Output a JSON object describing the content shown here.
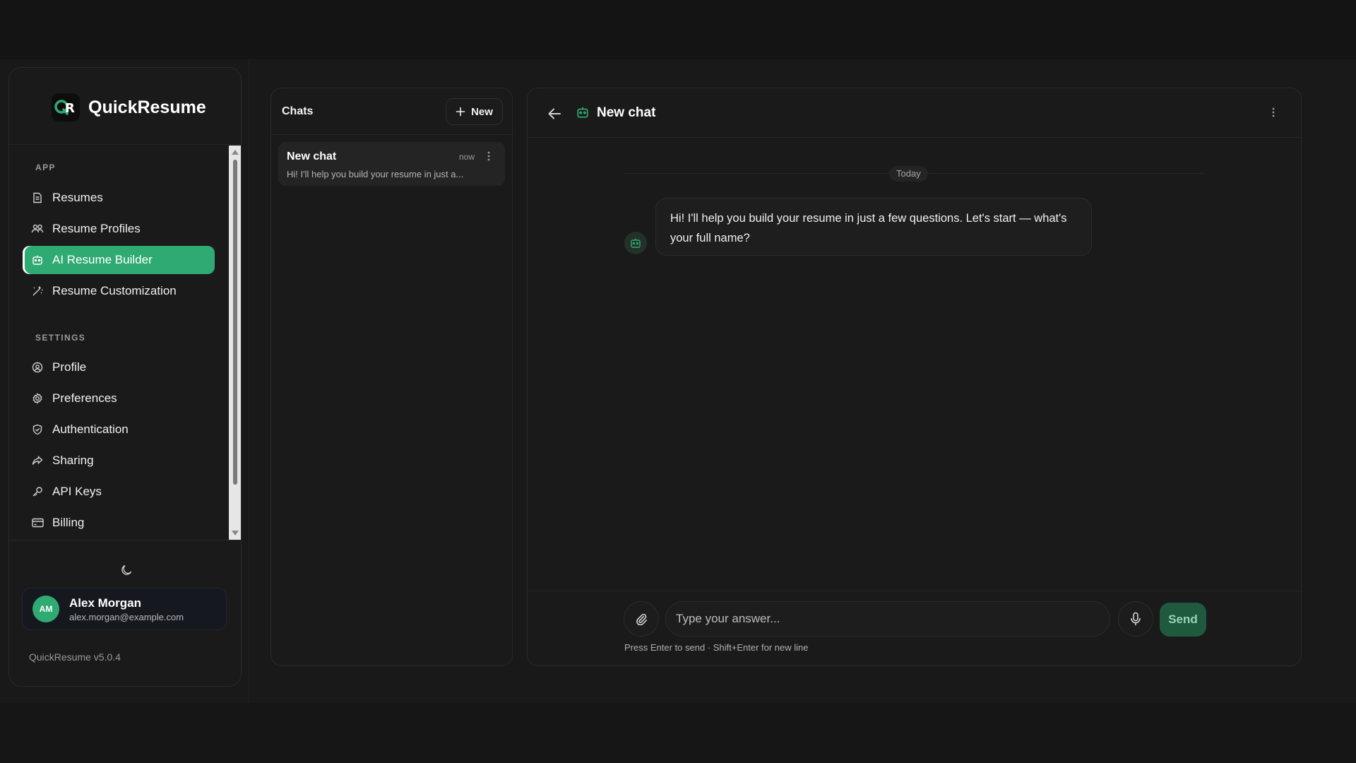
{
  "brand": {
    "name": "QuickResume",
    "logo_text": "QR"
  },
  "sidebar": {
    "section_app": "APP",
    "section_settings": "SETTINGS",
    "app_items": [
      {
        "label": "Resumes",
        "icon": "document-icon",
        "active": false
      },
      {
        "label": "Resume Profiles",
        "icon": "users-icon",
        "active": false
      },
      {
        "label": "AI Resume Builder",
        "icon": "bot-icon",
        "active": true
      },
      {
        "label": "Resume Customization",
        "icon": "magic-wand-icon",
        "active": false
      }
    ],
    "settings_items": [
      {
        "label": "Profile",
        "icon": "user-circle-icon"
      },
      {
        "label": "Preferences",
        "icon": "gear-icon"
      },
      {
        "label": "Authentication",
        "icon": "shield-icon"
      },
      {
        "label": "Sharing",
        "icon": "share-icon"
      },
      {
        "label": "API Keys",
        "icon": "key-icon"
      },
      {
        "label": "Billing",
        "icon": "credit-card-icon"
      }
    ],
    "theme_icon": "moon-icon",
    "user": {
      "initials": "AM",
      "name": "Alex Morgan",
      "email": "alex.morgan@example.com"
    },
    "version": "QuickResume v5.0.4"
  },
  "chats": {
    "title": "Chats",
    "new_label": "New",
    "items": [
      {
        "name": "New chat",
        "time": "now",
        "preview": "Hi! I'll help you build your resume in just a..."
      }
    ]
  },
  "conversation": {
    "title": "New chat",
    "date_label": "Today",
    "messages": [
      {
        "sender": "bot",
        "text": "Hi! I'll help you build your resume in just a few questions. Let's start — what's your full name?"
      }
    ],
    "input_placeholder": "Type your answer...",
    "send_label": "Send",
    "hint": "Press Enter to send · Shift+Enter for new line"
  },
  "colors": {
    "accent": "#2faa72",
    "send_bg": "#1f5a3f",
    "panel_bg": "#1a1a1a"
  }
}
